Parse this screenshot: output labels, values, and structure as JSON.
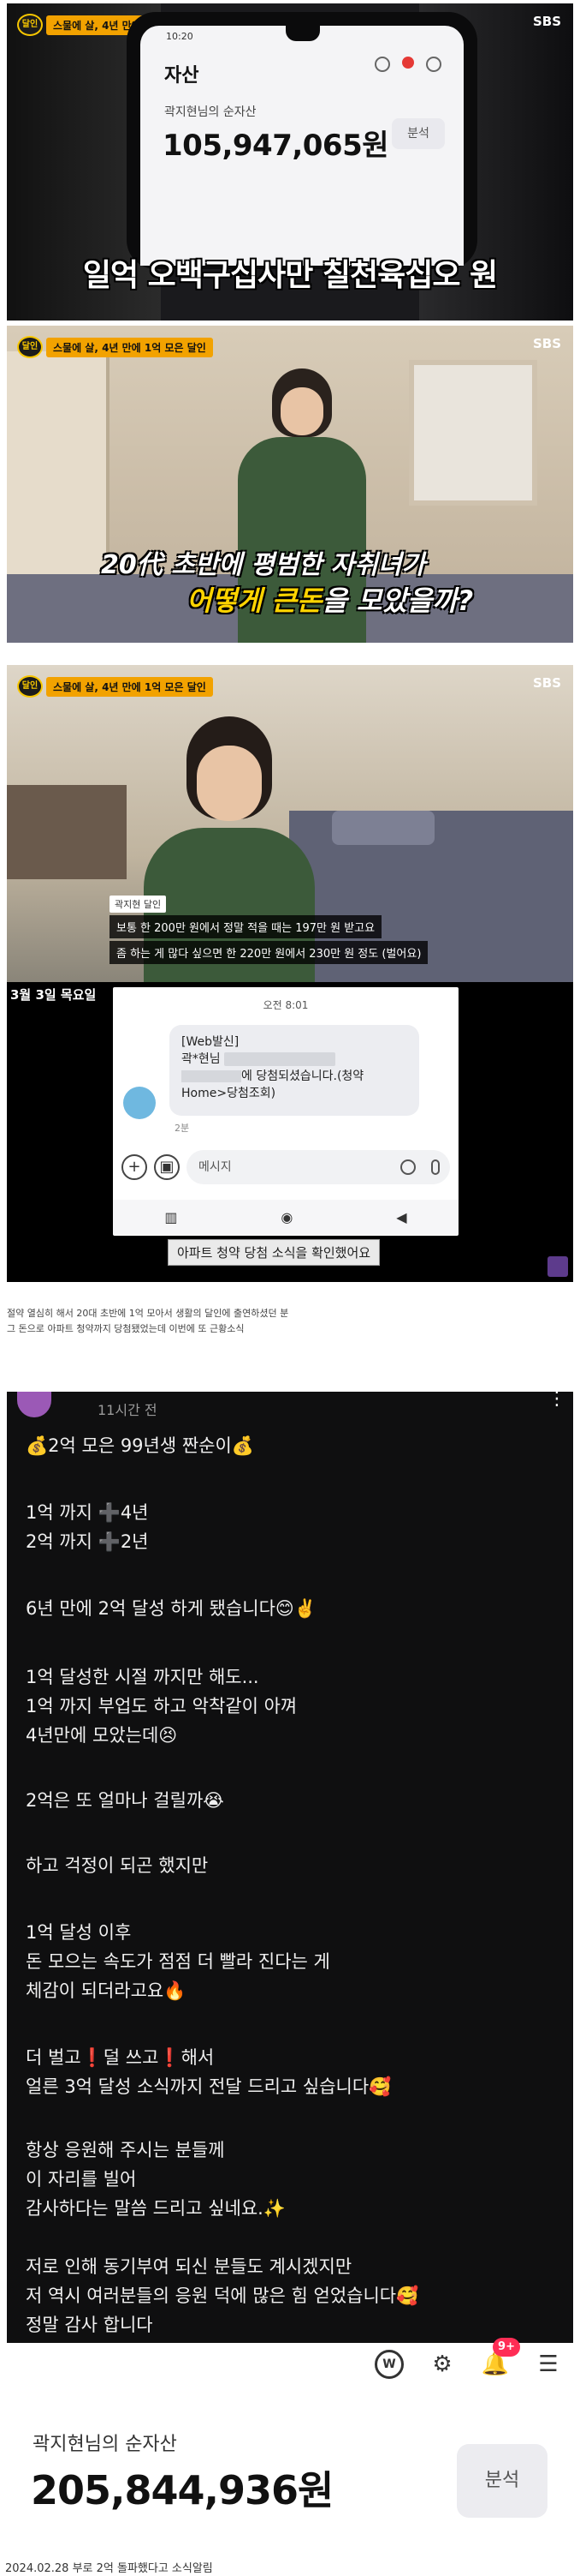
{
  "frame1": {
    "show_tag": "스물에 살, 4년 만에 1억 모은 달인",
    "sbs": "SBS",
    "status_time": "10:20",
    "asset_title": "자산",
    "owner": "곽지현님의 순자산",
    "amount": "105,947,065원",
    "analysis": "분석",
    "caption": "일억 오백구십사만 칠천육십오 원"
  },
  "frame2": {
    "show_tag": "스물에 살, 4년 만에 1억 모은 달인",
    "sbs": "SBS",
    "caption_line1": "20代 초반에 평범한 자취녀가",
    "caption_line2_a": "어떻게 큰돈",
    "caption_line2_b": "을 모았을까?"
  },
  "frame3": {
    "show_tag": "스물에 살, 4년 만에 1억 모은 달인",
    "sbs": "SBS",
    "name_tag": "곽지현 달인",
    "sub_line1": "보통 한 200만 원에서 정말 적을 때는 197만 원 받고요",
    "sub_line2": "좀 하는 게 많다 싶으면 한 220만 원에서 230만 원 정도 (벌어요)"
  },
  "frame4": {
    "date": "3월 3일 목요일",
    "time": "오전 8:01",
    "msg_line1": "[Web발신]",
    "msg_line2": "곽*현님",
    "msg_line3": "에 당첨되셨습니다.(청약",
    "msg_line4": "Home>당첨조회)",
    "ago": "2분",
    "input_placeholder": "메시지",
    "caption": "아파트 청약 당첨 소식을 확인했어요"
  },
  "description": {
    "line1": "절약 열심히 해서 20대 초반에 1억 모아서 생활의 달인에 출연하셨던 분",
    "line2": "그 돈으로 아파트 청약까지 당첨됐었는데 이번에 또 근황소식"
  },
  "post": {
    "ago": "11시간 전",
    "p1": "💰2억 모은 99년생 짠순이💰",
    "p2": "1억 까지 ➕4년\n2억 까지 ➕2년",
    "p3": "6년 만에 2억 달성 하게 됐습니다😊✌️",
    "p4": "1억 달성한 시절 까지만 해도...\n1억 까지 부업도 하고 악착같이 아껴\n4년만에 모았는데😣",
    "p5": "2억은 또 얼마나 걸릴까😭",
    "p6": "하고 걱정이 되곤 했지만",
    "p7": "1억 달성 이후\n돈 모으는 속도가 점점 더 빨라 진다는 게\n체감이 되더라고요🔥",
    "p8": "더 벌고❗️덜 쓰고❗️해서\n얼른 3억 달성 소식까지 전달 드리고 싶습니다🥰",
    "p9": "항상 응원해 주시는 분들께\n이 자리를 빌어\n감사하다는 말씀 드리고 싶네요.✨",
    "p10": "저로 인해 동기부여 되신 분들도 계시겠지만\n저 역시 여러분들의 응원 덕에 많은 힘 얻었습니다🥰\n정말 감사 합니다"
  },
  "app": {
    "notif_badge": "9+",
    "owner": "곽지현님의 순자산",
    "amount": "205,844,936원",
    "analysis": "분석"
  },
  "footer": "2024.02.28 부로 2억 돌파했다고 소식알림"
}
